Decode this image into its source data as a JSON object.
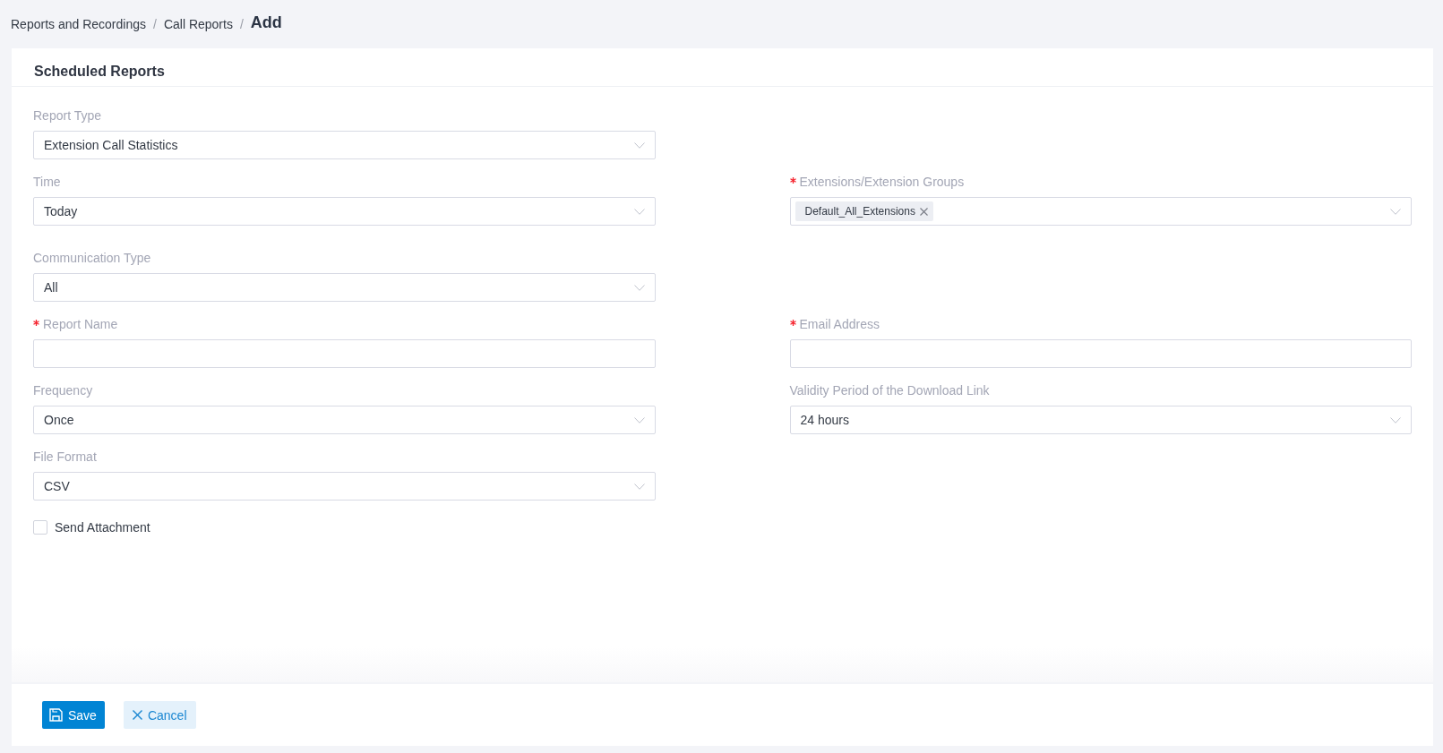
{
  "breadcrumb": [
    {
      "label": "Reports and Recordings",
      "kind": "link"
    },
    {
      "separator": "/",
      "label": "Call Reports",
      "kind": "link"
    },
    {
      "separator": "/",
      "label": "Add",
      "kind": "current"
    }
  ],
  "panel": {
    "title": "Scheduled Reports"
  },
  "form": {
    "rows": [
      {
        "fields": [
          {
            "label": "Report Type",
            "required": false,
            "kind": "select",
            "value": "Extension Call Statistics"
          }
        ]
      },
      {
        "fields": [
          {
            "label": "Time",
            "required": false,
            "kind": "select",
            "value": "Today"
          },
          {
            "label": "Extensions/Extension Groups",
            "required": true,
            "kind": "tags",
            "tags": [
              "Default_All_Extensions"
            ]
          }
        ]
      },
      {
        "fields": [
          {
            "label": "Communication Type",
            "required": false,
            "kind": "select",
            "value": "All"
          }
        ]
      },
      {
        "fields": [
          {
            "label": "Report Name",
            "required": true,
            "kind": "input"
          },
          {
            "label": "Email Address",
            "required": true,
            "kind": "input"
          }
        ]
      },
      {
        "fields": [
          {
            "label": "Frequency",
            "required": false,
            "kind": "select",
            "value": "Once"
          },
          {
            "label": "Validity Period of the Download Link",
            "required": false,
            "kind": "select",
            "value": "24 hours"
          }
        ]
      },
      {
        "fields": [
          {
            "label": "File Format",
            "required": false,
            "kind": "select",
            "value": "CSV"
          }
        ]
      }
    ],
    "checkbox": {
      "label": "Send Attachment",
      "checked": false
    }
  },
  "buttons": [
    {
      "label": "Save",
      "kind": "primary"
    },
    {
      "label": "Cancel",
      "kind": "secondary"
    }
  ]
}
